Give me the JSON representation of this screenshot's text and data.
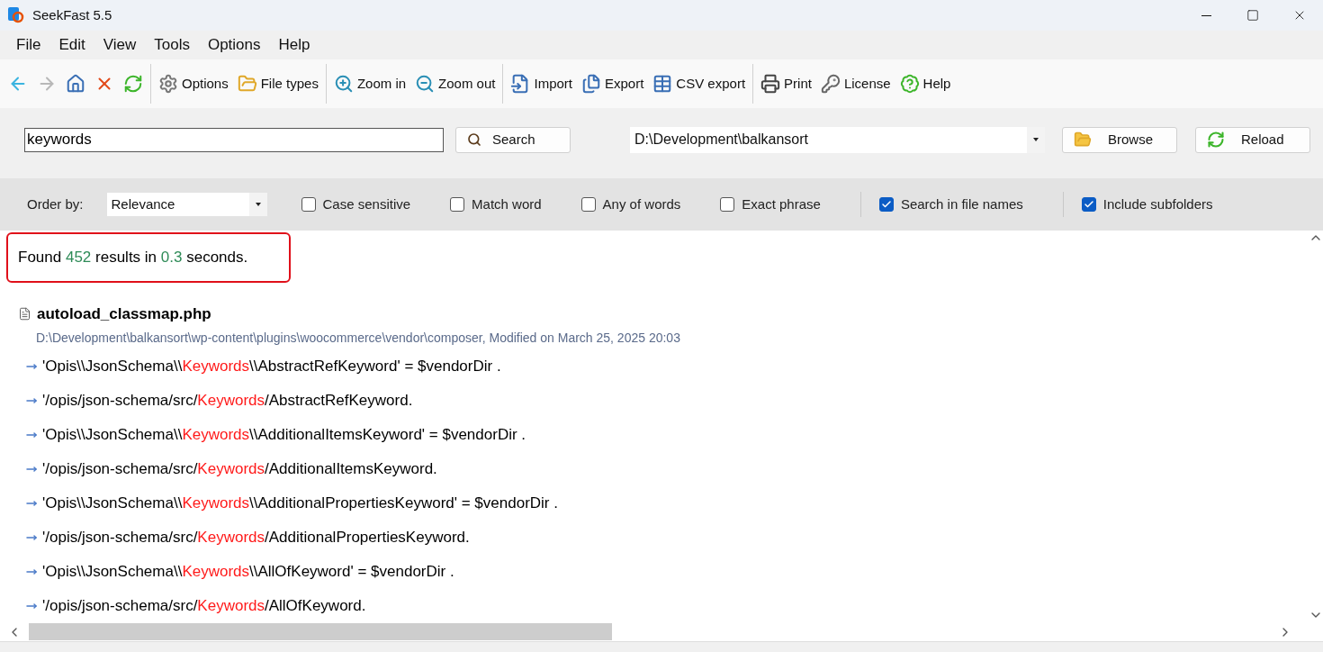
{
  "window": {
    "title": "SeekFast 5.5"
  },
  "menu": [
    "File",
    "Edit",
    "View",
    "Tools",
    "Options",
    "Help"
  ],
  "toolbar": [
    [
      {
        "disabled": false
      },
      {
        "disabled": true
      },
      {
        "disabled": false
      },
      {
        "disabled": false
      },
      {
        "disabled": false
      }
    ],
    [
      {
        "label": "Options"
      },
      {
        "label": "File types"
      }
    ],
    [
      {
        "label": "Zoom in"
      },
      {
        "label": "Zoom out"
      }
    ],
    [
      {
        "label": "Import"
      },
      {
        "label": "Export"
      },
      {
        "label": "CSV export"
      }
    ],
    [
      {
        "label": "Print"
      },
      {
        "label": "License"
      },
      {
        "label": "Help"
      }
    ]
  ],
  "search": {
    "value": "keywords",
    "button": "Search",
    "folder": "D:\\Development\\balkansort",
    "browse": "Browse",
    "reload": "Reload"
  },
  "options": {
    "order_label": "Order by:",
    "order_value": "Relevance",
    "checks": [
      {
        "label": "Case sensitive",
        "checked": false,
        "divider_before": false
      },
      {
        "label": "Match word",
        "checked": false,
        "divider_before": false
      },
      {
        "label": "Any of words",
        "checked": false,
        "divider_before": false
      },
      {
        "label": "Exact phrase",
        "checked": false,
        "divider_before": false
      },
      {
        "label": "Search in file names",
        "checked": true,
        "divider_before": true
      },
      {
        "label": "Include subfolders",
        "checked": true,
        "divider_before": true
      }
    ]
  },
  "summary": {
    "prefix": "Found",
    "count": "452",
    "middle": "results in",
    "time": "0.3",
    "suffix": "seconds."
  },
  "file": {
    "name": "autoload_classmap.php",
    "path": "D:\\Development\\balkansort\\wp-content\\plugins\\woocommerce\\vendor\\composer, Modified on March 25, 2025 20:03"
  },
  "lines": [
    {
      "before": "'Opis\\\\JsonSchema\\\\",
      "match": "Keywords",
      "after": "\\\\AbstractRefKeyword' = $vendorDir ."
    },
    {
      "before": "'/opis/json-schema/src/",
      "match": "Keywords",
      "after": "/AbstractRefKeyword."
    },
    {
      "before": "'Opis\\\\JsonSchema\\\\",
      "match": "Keywords",
      "after": "\\\\AdditionalItemsKeyword' = $vendorDir ."
    },
    {
      "before": "'/opis/json-schema/src/",
      "match": "Keywords",
      "after": "/AdditionalItemsKeyword."
    },
    {
      "before": "'Opis\\\\JsonSchema\\\\",
      "match": "Keywords",
      "after": "\\\\AdditionalPropertiesKeyword' = $vendorDir ."
    },
    {
      "before": "'/opis/json-schema/src/",
      "match": "Keywords",
      "after": "/AdditionalPropertiesKeyword."
    },
    {
      "before": "'Opis\\\\JsonSchema\\\\",
      "match": "Keywords",
      "after": "\\\\AllOfKeyword' = $vendorDir ."
    },
    {
      "before": "'/opis/json-schema/src/",
      "match": "Keywords",
      "after": "/AllOfKeyword."
    }
  ]
}
